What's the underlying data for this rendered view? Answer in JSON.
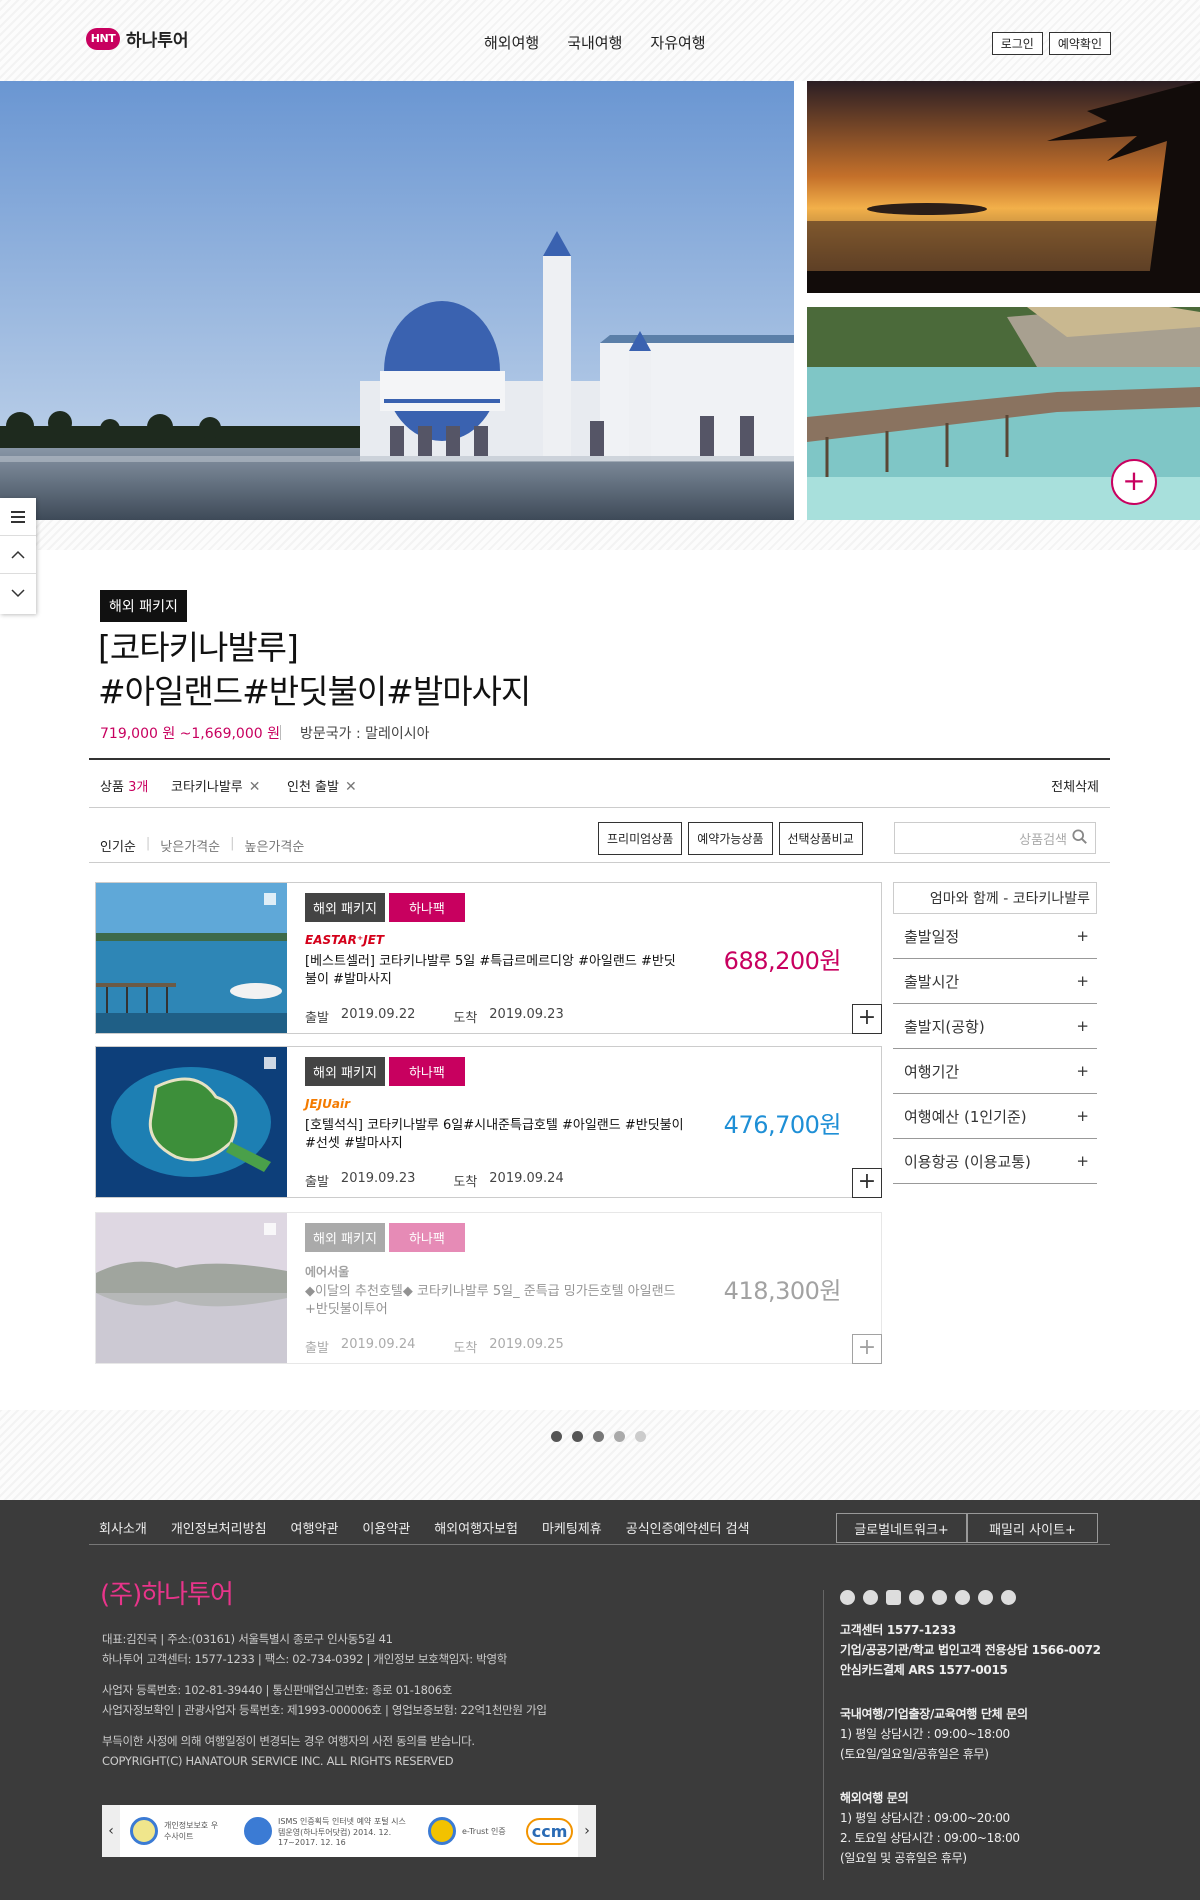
{
  "header": {
    "logo_mark": "HNT",
    "logo_name": "하나투어",
    "nav": [
      "해외여행",
      "국내여행",
      "자유여행"
    ],
    "login": "로그인",
    "reservation": "예약확인"
  },
  "quick": {
    "menu_icon": "menu-icon",
    "up_icon": "chevron-up-icon",
    "down_icon": "chevron-down-icon"
  },
  "hero": {
    "plus": "+"
  },
  "product": {
    "badge": "해외 패키지",
    "title_line1": "[코타키나발루]",
    "title_line2": "#아일랜드#반딧불이#발마사지",
    "price_range": "719,000 원 ~1,669,000 원",
    "country": "방문국가 : 말레이시아"
  },
  "filterbar": {
    "count_prefix": "상품 ",
    "count": "3개",
    "tag1": "코타키나발루",
    "tag2": "인천 출발",
    "clear_all": "전체삭제"
  },
  "sort": {
    "options": [
      "인기순",
      "낮은가격순",
      "높은가격순"
    ],
    "buttons": [
      "프리미엄상품",
      "예약가능상품",
      "선택상품비교"
    ],
    "search_placeholder": "상품검색"
  },
  "cards": [
    {
      "tag1": "해외 패키지",
      "tag2": "하나팩",
      "airline": "EASTAR⁺JET",
      "name": "[베스트셀러] 코타키나발루 5일 #특급르메르디앙 #아일랜드 #반딧불이 #발마사지",
      "depart_label": "출발",
      "depart": "2019.09.22",
      "arrive_label": "도착",
      "arrive": "2019.09.23",
      "price": "688,200원",
      "price_color": "#c8005f"
    },
    {
      "tag1": "해외 패키지",
      "tag2": "하나팩",
      "airline": "JEJUair",
      "name": "[호텔석식] 코타키나발루 6일#시내준특급호텔 #아일랜드 #반딧불이 #선셋 #발마사지",
      "depart_label": "출발",
      "depart": "2019.09.23",
      "arrive_label": "도착",
      "arrive": "2019.09.24",
      "price": "476,700원",
      "price_color": "#1e8fd6"
    },
    {
      "tag1": "해외 패키지",
      "tag2": "하나팩",
      "airline": "에어서울",
      "name": "◆이달의 추천호텔◆ 코타키나발루 5일_ 준특급 밍가든호텔 아일랜드+반딧불이투어",
      "depart_label": "출발",
      "depart": "2019.09.24",
      "arrive_label": "도착",
      "arrive": "2019.09.25",
      "price": "418,300원",
      "price_color": "#333333"
    }
  ],
  "sidefilter": {
    "head": "엄마와 함께 - 코타키나발루",
    "rows": [
      "출발일정",
      "출발시간",
      "출발지(공항)",
      "여행기간",
      "여행예산 (1인기준)",
      "이용항공 (이용교통)"
    ]
  },
  "footer": {
    "nav": [
      "회사소개",
      "개인정보처리방침",
      "여행약관",
      "이용약관",
      "해외여행자보험",
      "마케팅제휴",
      "공식인증예약센터 검색"
    ],
    "btn_global": "글로벌네트워크+",
    "btn_family": "패밀리 사이트+",
    "company": "(주)하나투어",
    "info1": "대표:김진국 | 주소:(03161) 서울특별시 종로구 인사동5길 41",
    "info2": "하나투어 고객센터: 1577-1233 | 팩스: 02-734-0392 | 개인정보 보호책임자: 박영학",
    "info3": "사업자 등록번호: 102-81-39440 | 통신판매업신고번호: 종로 01-1806호",
    "info4": "사업자정보확인 | 관광사업자 등록번호: 제1993-000006호 | 영업보증보험: 22억1천만원 가입",
    "info5": "부득이한 사정에 의해 여행일정이 변경되는 경우 여행자의 사전 동의를 받습니다.",
    "info6": "COPYRIGHT(C) HANATOUR SERVICE INC. ALL RIGHTS RESERVED",
    "cert1": "개인정보보호 우수사이트",
    "cert2": "ISMS 인증획득 인터넷 예약 포털 시스템운영(하나투어닷컴) 2014. 12. 17~2017. 12. 16",
    "cert3": "e-Trust 인증",
    "cert4": "ccm",
    "cs1_label": "고객센터 ",
    "cs1": "1577-1233",
    "cs2": "기업/공공기관/학교 법인고객 전용상담 1566-0072",
    "cs3": "안심카드결제 ARS 1577-0015",
    "cs4": "국내여행/기업출장/교육여행 단체 문의",
    "cs5": "1) 평일 상담시간 : 09:00~18:00",
    "cs6": "(토요일/일요일/공휴일은 휴무)",
    "cs7": "해외여행 문의",
    "cs8": "1) 평일 상담시간 : 09:00~20:00",
    "cs9": "2. 토요일 상담시간 : 09:00~18:00",
    "cs10": "(일요일 및 공휴일은 휴무)"
  }
}
